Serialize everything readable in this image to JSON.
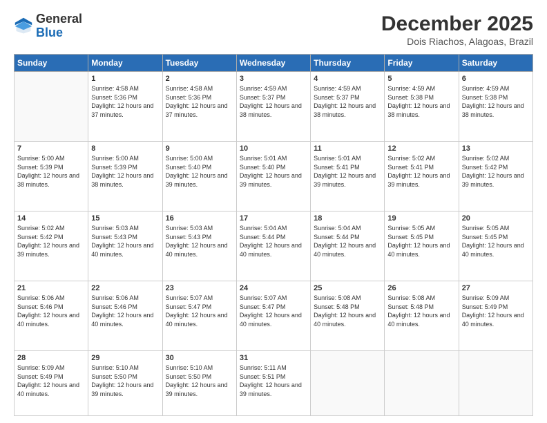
{
  "header": {
    "logo_general": "General",
    "logo_blue": "Blue",
    "month_title": "December 2025",
    "location": "Dois Riachos, Alagoas, Brazil"
  },
  "days_of_week": [
    "Sunday",
    "Monday",
    "Tuesday",
    "Wednesday",
    "Thursday",
    "Friday",
    "Saturday"
  ],
  "weeks": [
    [
      {
        "day": "",
        "sunrise": "",
        "sunset": "",
        "daylight": ""
      },
      {
        "day": "1",
        "sunrise": "Sunrise: 4:58 AM",
        "sunset": "Sunset: 5:36 PM",
        "daylight": "Daylight: 12 hours and 37 minutes."
      },
      {
        "day": "2",
        "sunrise": "Sunrise: 4:58 AM",
        "sunset": "Sunset: 5:36 PM",
        "daylight": "Daylight: 12 hours and 37 minutes."
      },
      {
        "day": "3",
        "sunrise": "Sunrise: 4:59 AM",
        "sunset": "Sunset: 5:37 PM",
        "daylight": "Daylight: 12 hours and 38 minutes."
      },
      {
        "day": "4",
        "sunrise": "Sunrise: 4:59 AM",
        "sunset": "Sunset: 5:37 PM",
        "daylight": "Daylight: 12 hours and 38 minutes."
      },
      {
        "day": "5",
        "sunrise": "Sunrise: 4:59 AM",
        "sunset": "Sunset: 5:38 PM",
        "daylight": "Daylight: 12 hours and 38 minutes."
      },
      {
        "day": "6",
        "sunrise": "Sunrise: 4:59 AM",
        "sunset": "Sunset: 5:38 PM",
        "daylight": "Daylight: 12 hours and 38 minutes."
      }
    ],
    [
      {
        "day": "7",
        "sunrise": "Sunrise: 5:00 AM",
        "sunset": "Sunset: 5:39 PM",
        "daylight": "Daylight: 12 hours and 38 minutes."
      },
      {
        "day": "8",
        "sunrise": "Sunrise: 5:00 AM",
        "sunset": "Sunset: 5:39 PM",
        "daylight": "Daylight: 12 hours and 38 minutes."
      },
      {
        "day": "9",
        "sunrise": "Sunrise: 5:00 AM",
        "sunset": "Sunset: 5:40 PM",
        "daylight": "Daylight: 12 hours and 39 minutes."
      },
      {
        "day": "10",
        "sunrise": "Sunrise: 5:01 AM",
        "sunset": "Sunset: 5:40 PM",
        "daylight": "Daylight: 12 hours and 39 minutes."
      },
      {
        "day": "11",
        "sunrise": "Sunrise: 5:01 AM",
        "sunset": "Sunset: 5:41 PM",
        "daylight": "Daylight: 12 hours and 39 minutes."
      },
      {
        "day": "12",
        "sunrise": "Sunrise: 5:02 AM",
        "sunset": "Sunset: 5:41 PM",
        "daylight": "Daylight: 12 hours and 39 minutes."
      },
      {
        "day": "13",
        "sunrise": "Sunrise: 5:02 AM",
        "sunset": "Sunset: 5:42 PM",
        "daylight": "Daylight: 12 hours and 39 minutes."
      }
    ],
    [
      {
        "day": "14",
        "sunrise": "Sunrise: 5:02 AM",
        "sunset": "Sunset: 5:42 PM",
        "daylight": "Daylight: 12 hours and 39 minutes."
      },
      {
        "day": "15",
        "sunrise": "Sunrise: 5:03 AM",
        "sunset": "Sunset: 5:43 PM",
        "daylight": "Daylight: 12 hours and 40 minutes."
      },
      {
        "day": "16",
        "sunrise": "Sunrise: 5:03 AM",
        "sunset": "Sunset: 5:43 PM",
        "daylight": "Daylight: 12 hours and 40 minutes."
      },
      {
        "day": "17",
        "sunrise": "Sunrise: 5:04 AM",
        "sunset": "Sunset: 5:44 PM",
        "daylight": "Daylight: 12 hours and 40 minutes."
      },
      {
        "day": "18",
        "sunrise": "Sunrise: 5:04 AM",
        "sunset": "Sunset: 5:44 PM",
        "daylight": "Daylight: 12 hours and 40 minutes."
      },
      {
        "day": "19",
        "sunrise": "Sunrise: 5:05 AM",
        "sunset": "Sunset: 5:45 PM",
        "daylight": "Daylight: 12 hours and 40 minutes."
      },
      {
        "day": "20",
        "sunrise": "Sunrise: 5:05 AM",
        "sunset": "Sunset: 5:45 PM",
        "daylight": "Daylight: 12 hours and 40 minutes."
      }
    ],
    [
      {
        "day": "21",
        "sunrise": "Sunrise: 5:06 AM",
        "sunset": "Sunset: 5:46 PM",
        "daylight": "Daylight: 12 hours and 40 minutes."
      },
      {
        "day": "22",
        "sunrise": "Sunrise: 5:06 AM",
        "sunset": "Sunset: 5:46 PM",
        "daylight": "Daylight: 12 hours and 40 minutes."
      },
      {
        "day": "23",
        "sunrise": "Sunrise: 5:07 AM",
        "sunset": "Sunset: 5:47 PM",
        "daylight": "Daylight: 12 hours and 40 minutes."
      },
      {
        "day": "24",
        "sunrise": "Sunrise: 5:07 AM",
        "sunset": "Sunset: 5:47 PM",
        "daylight": "Daylight: 12 hours and 40 minutes."
      },
      {
        "day": "25",
        "sunrise": "Sunrise: 5:08 AM",
        "sunset": "Sunset: 5:48 PM",
        "daylight": "Daylight: 12 hours and 40 minutes."
      },
      {
        "day": "26",
        "sunrise": "Sunrise: 5:08 AM",
        "sunset": "Sunset: 5:48 PM",
        "daylight": "Daylight: 12 hours and 40 minutes."
      },
      {
        "day": "27",
        "sunrise": "Sunrise: 5:09 AM",
        "sunset": "Sunset: 5:49 PM",
        "daylight": "Daylight: 12 hours and 40 minutes."
      }
    ],
    [
      {
        "day": "28",
        "sunrise": "Sunrise: 5:09 AM",
        "sunset": "Sunset: 5:49 PM",
        "daylight": "Daylight: 12 hours and 40 minutes."
      },
      {
        "day": "29",
        "sunrise": "Sunrise: 5:10 AM",
        "sunset": "Sunset: 5:50 PM",
        "daylight": "Daylight: 12 hours and 39 minutes."
      },
      {
        "day": "30",
        "sunrise": "Sunrise: 5:10 AM",
        "sunset": "Sunset: 5:50 PM",
        "daylight": "Daylight: 12 hours and 39 minutes."
      },
      {
        "day": "31",
        "sunrise": "Sunrise: 5:11 AM",
        "sunset": "Sunset: 5:51 PM",
        "daylight": "Daylight: 12 hours and 39 minutes."
      },
      {
        "day": "",
        "sunrise": "",
        "sunset": "",
        "daylight": ""
      },
      {
        "day": "",
        "sunrise": "",
        "sunset": "",
        "daylight": ""
      },
      {
        "day": "",
        "sunrise": "",
        "sunset": "",
        "daylight": ""
      }
    ]
  ]
}
